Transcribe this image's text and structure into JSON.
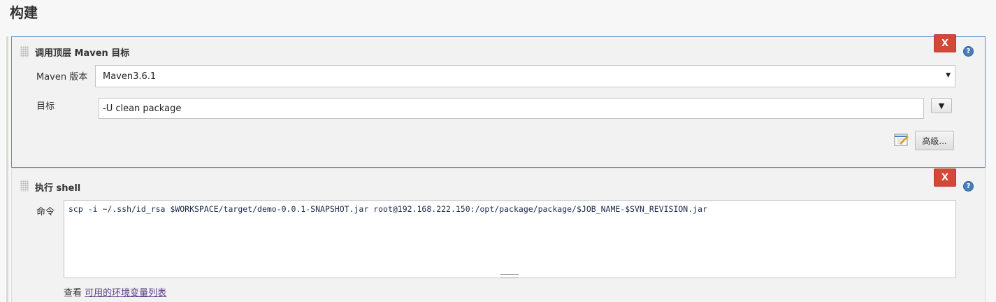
{
  "section_title": "构建",
  "maven_step": {
    "title": "调用顶层 Maven 目标",
    "close_label": "X",
    "help_label": "?",
    "version_label": "Maven 版本",
    "version_value": "Maven3.6.1",
    "goals_label": "目标",
    "goals_value": "-U clean package",
    "expand_label": "▼",
    "advanced_label": "高级..."
  },
  "shell_step": {
    "title": "执行 shell",
    "close_label": "X",
    "help_label": "?",
    "command_label": "命令",
    "command_value": "scp -i ~/.ssh/id_rsa $WORKSPACE/target/demo-0.0.1-SNAPSHOT.jar root@192.168.222.150:/opt/package/package/$JOB_NAME-$SVN_REVISION.jar",
    "view_prefix": "查看",
    "env_link": "可用的环境变量列表"
  }
}
